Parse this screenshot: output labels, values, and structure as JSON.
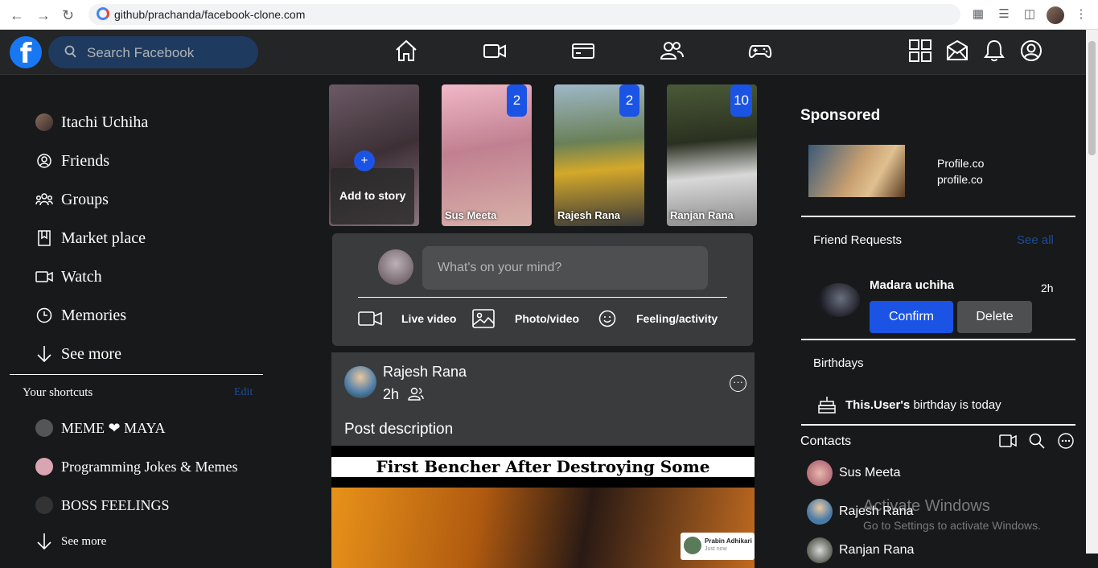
{
  "browser": {
    "url": "github/prachanda/facebook-clone.com"
  },
  "header": {
    "logo": "f",
    "search_placeholder": "Search Facebook"
  },
  "left_menu": {
    "profile": "Itachi Uchiha",
    "items": [
      "Friends",
      "Groups",
      "Market place",
      "Watch",
      "Memories",
      "See more"
    ],
    "shortcuts_title": "Your shortcuts",
    "edit_label": "Edit",
    "shortcuts": [
      "MEME ❤ MAYA",
      "Programming Jokes & Memes",
      "BOSS FEELINGS"
    ],
    "shortcuts_see_more": "See more"
  },
  "stories": {
    "add_label": "Add to story",
    "add_plus": "+",
    "items": [
      {
        "name": "Sus Meeta",
        "count": "2"
      },
      {
        "name": "Rajesh Rana",
        "count": "2"
      },
      {
        "name": "Ranjan Rana",
        "count": "10"
      }
    ]
  },
  "composer": {
    "placeholder": "What's on your mind?",
    "live": "Live video",
    "photo": "Photo/video",
    "feeling": "Feeling/activity"
  },
  "post": {
    "author": "Rajesh Rana",
    "time": "2h",
    "description": "Post description",
    "meme_caption": "First Bencher After Destroying Some Buildings*",
    "tag_name": "Prabin Adhikari",
    "tag_sub": "Just now"
  },
  "right": {
    "sponsored_title": "Sponsored",
    "sponsor_name": "Profile.co",
    "sponsor_url": "profile.co",
    "friend_requests": "Friend Requests",
    "see_all": "See all",
    "requester": "Madara uchiha",
    "request_time": "2h",
    "confirm": "Confirm",
    "delete": "Delete",
    "birthdays": "Birthdays",
    "birthday_name": "This.User's",
    "birthday_rest": " birthday is today",
    "contacts": "Contacts",
    "contact_list": [
      "Sus Meeta",
      "Rajesh Rana",
      "Ranjan Rana"
    ]
  },
  "watermark": {
    "line1": "Activate Windows",
    "line2": "Go to Settings to activate Windows."
  },
  "colors": {
    "accent": "#1b54e5",
    "topbar": "#242526",
    "card": "#3a3b3c",
    "background": "#18191a"
  }
}
